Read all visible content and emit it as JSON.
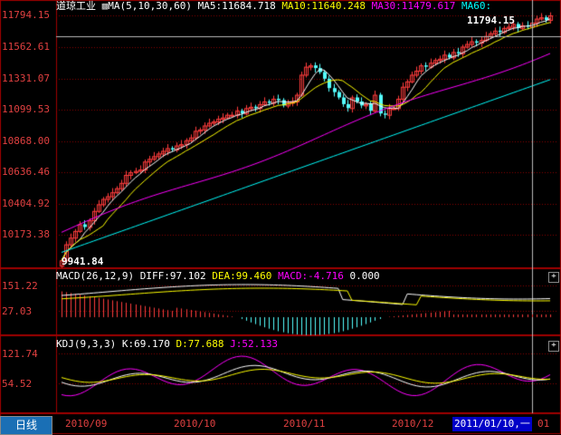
{
  "header": {
    "instrument": "道琼工业",
    "ma_group_label": "MA(5,10,30,60)",
    "ma5": "MA5:11684.718",
    "ma10": "MA10:11640.248",
    "ma30": "MA30:11479.617",
    "ma60": "MA60:"
  },
  "colors": {
    "candle_up": "#ff3c3c",
    "candle_down": "#54ffff",
    "ma5": "#ffffff",
    "ma10": "#ffff00",
    "ma30": "#ff00ff",
    "ma60": "#00ffff",
    "grid": "#8b0000",
    "axis_text": "#e04040"
  },
  "price_panel": {
    "y_ticks": [
      "11794.15",
      "11562.61",
      "11331.07",
      "11099.53",
      "10868.00",
      "10636.46",
      "10404.92",
      "10173.38"
    ],
    "high_label": "11794.15",
    "low_label": "9941.84"
  },
  "macd_panel": {
    "title": "MACD(26,12,9)",
    "diff": "DIFF:97.102",
    "dea": "DEA:99.460",
    "macd": "MACD:-4.716",
    "extra": "0.000",
    "y_ticks": [
      "151.22",
      "27.03"
    ]
  },
  "kdj_panel": {
    "title": "KDJ(9,3,3)",
    "k": "K:69.170",
    "d": "D:77.688",
    "j": "J:52.133",
    "y_ticks": [
      "121.74",
      "54.52"
    ]
  },
  "footer": {
    "period_tab": "日线",
    "x_labels": [
      "2010/09",
      "2010/10",
      "2010/11",
      "2010/12"
    ],
    "cursor_date": "2011/01/10,一",
    "cursor_suffix": "01"
  },
  "chart_data": {
    "type": "candlestick",
    "ylim": [
      9941.84,
      11794.15
    ],
    "close": [
      9960,
      10080,
      10130,
      10180,
      10230,
      10210,
      10260,
      10330,
      10380,
      10420,
      10440,
      10470,
      10500,
      10540,
      10600,
      10620,
      10630,
      10640,
      10700,
      10720,
      10740,
      10760,
      10780,
      10800,
      10790,
      10820,
      10830,
      10860,
      10880,
      10930,
      10940,
      10970,
      10990,
      11000,
      11020,
      11030,
      11050,
      11050,
      11080,
      11060,
      11100,
      11110,
      11100,
      11130,
      11150,
      11140,
      11170,
      11160,
      11120,
      11140,
      11150,
      11200,
      11350,
      11410,
      11420,
      11400,
      11370,
      11320,
      11250,
      11220,
      11180,
      11130,
      11100,
      11180,
      11150,
      11120,
      11130,
      11080,
      11200,
      11060,
      11050,
      11100,
      11100,
      11170,
      11260,
      11300,
      11350,
      11380,
      11420,
      11410,
      11440,
      11460,
      11470,
      11500,
      11480,
      11520,
      11510,
      11560,
      11580,
      11600,
      11590,
      11610,
      11640,
      11660,
      11680,
      11670,
      11700,
      11710,
      11730,
      11700,
      11720,
      11710,
      11740,
      11770,
      11780,
      11760,
      11794
    ]
  }
}
